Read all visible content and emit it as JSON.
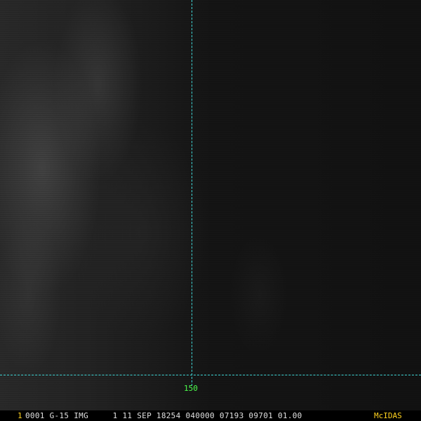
{
  "window": {
    "image_description_type": "satellite-image"
  },
  "grid": {
    "longitude_label": "150",
    "line_color": "#3fd6d6",
    "label_color": "#4cff4c"
  },
  "status_bar": {
    "frame_number": "1",
    "frame_info": "0001 G-15 IMG     1 11 SEP 18254 040000 07193 09701 01.00",
    "logo": "McIDAS",
    "frame_number_color": "#ffd21f",
    "info_color": "#e0e0e0",
    "logo_color": "#ffd21f"
  }
}
